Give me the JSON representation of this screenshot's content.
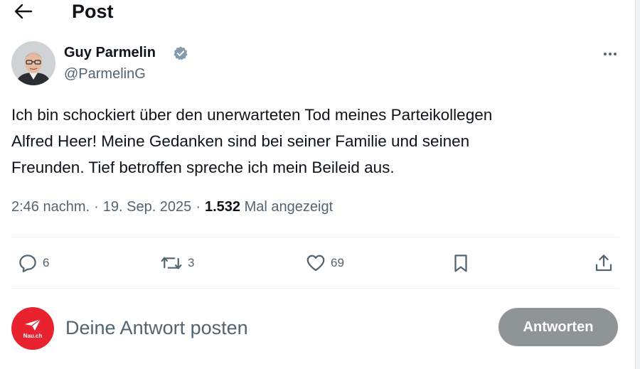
{
  "header": {
    "title": "Post",
    "back_icon": "arrow-left-icon"
  },
  "author": {
    "name": "Guy Parmelin",
    "handle": "@ParmelinG",
    "verified": true,
    "verified_color": "#829aab"
  },
  "post": {
    "lines": [
      "Ich bin schockiert über den unerwarteten Tod meines Parteikollegen",
      "Alfred Heer! Meine Gedanken sind bei seiner Familie und seinen",
      "Freunden. Tief betroffen spreche ich mein Beileid aus."
    ],
    "time": "2:46 nachm.",
    "date": "19. Sep. 2025",
    "separator": "·",
    "views_count": "1.532",
    "views_label": "Mal angezeigt"
  },
  "actions": {
    "replies": "6",
    "reposts": "3",
    "likes": "69",
    "reply_icon": "comment-icon",
    "repost_icon": "repost-icon",
    "like_icon": "heart-icon",
    "bookmark_icon": "bookmark-icon",
    "share_icon": "share-icon"
  },
  "reply_box": {
    "avatar_text": "Nau.ch",
    "placeholder": "Deine Antwort posten",
    "button_label": "Antworten",
    "avatar_color": "#e8232f"
  }
}
